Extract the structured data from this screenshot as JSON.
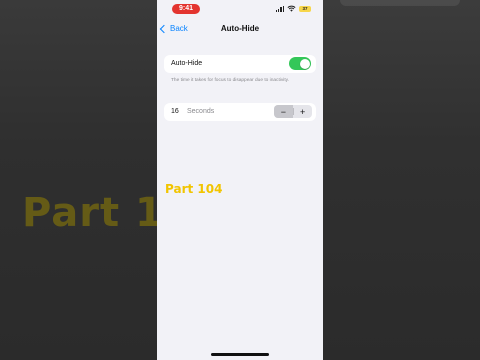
{
  "status_bar": {
    "time": "9:41",
    "battery": "37"
  },
  "nav": {
    "back_label": "Back",
    "title": "Auto-Hide"
  },
  "auto_hide": {
    "label": "Auto-Hide",
    "enabled": true,
    "footnote": "The time it takes for focus to disappear due to inactivity."
  },
  "timeout": {
    "value": "16",
    "unit": "Seconds",
    "decrement_symbol": "−",
    "increment_symbol": "+"
  },
  "overlay": {
    "caption": "Part 104"
  },
  "colors": {
    "toggle_on": "#34c759",
    "link": "#0a84ff",
    "time_pill": "#e3342f",
    "caption": "#f2c500"
  }
}
